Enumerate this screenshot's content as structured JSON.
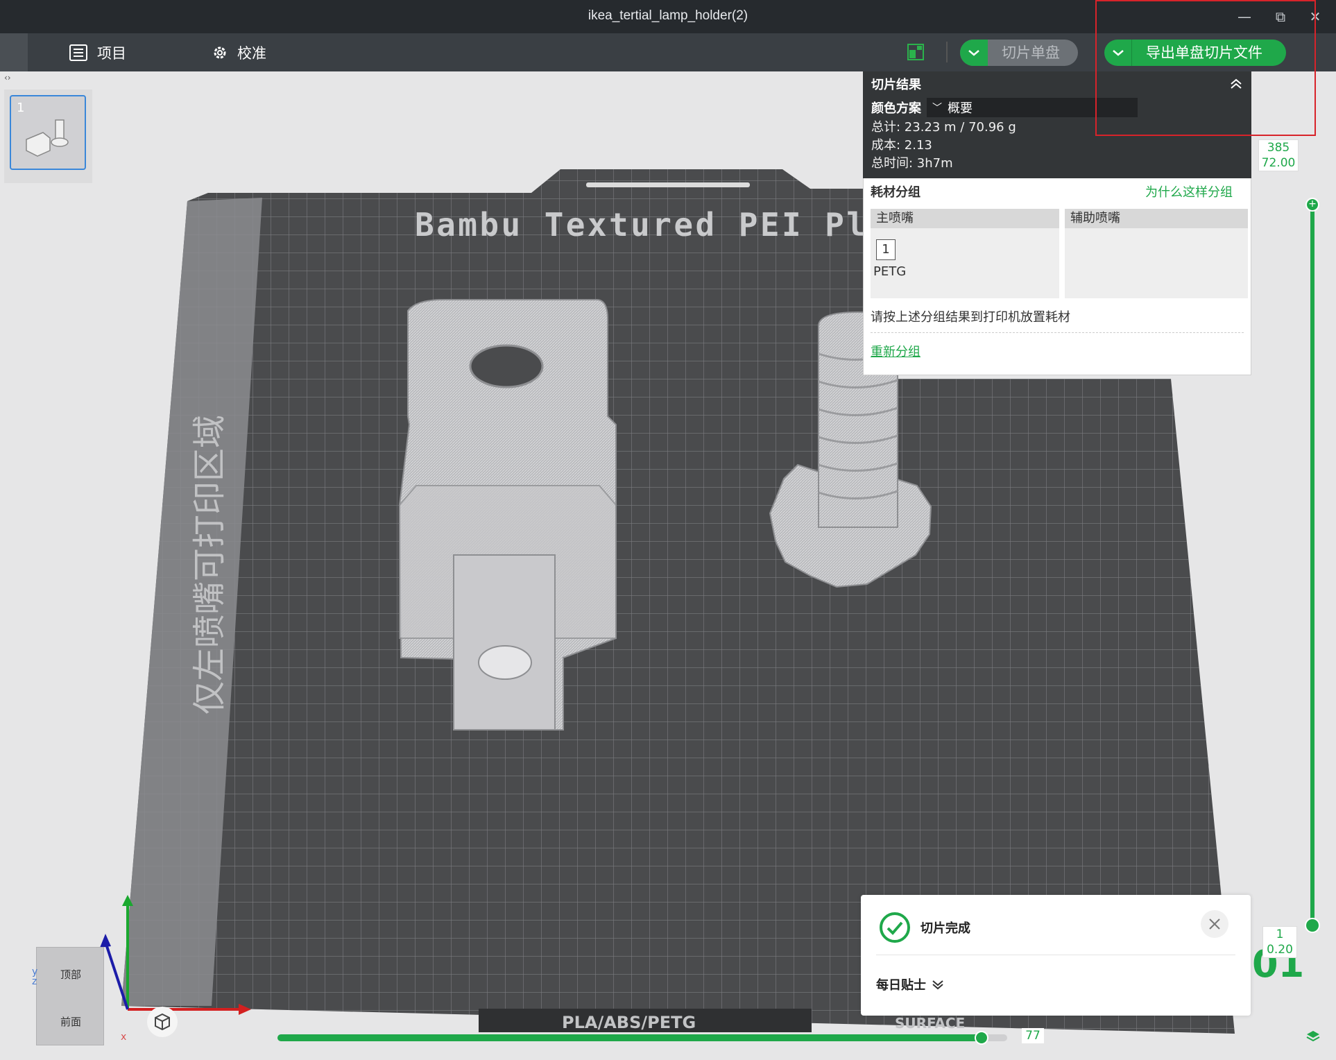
{
  "window": {
    "title": "ikea_tertial_lamp_holder(2)",
    "minimize": "—",
    "restore": "⧉",
    "close": "✕"
  },
  "menubar": {
    "project_label": "项目",
    "calibrate_label": "校准",
    "slice_label": "切片单盘",
    "export_label": "导出单盘切片文件"
  },
  "plate_list": {
    "plate_number": "1"
  },
  "scene": {
    "plate_brand": "Bambu Textured PEI Pl",
    "left_nozzle_area": "仅左喷嘴可打印区域",
    "plate_bottom_text": "PLA/ABS/PETG",
    "plate_bottom_text2": "SURFACE",
    "overlap_text": "01"
  },
  "slice_result": {
    "title": "切片结果",
    "color_scheme_label": "颜色方案",
    "color_scheme_value": "概要",
    "total": "总计: 23.23 m / 70.96 g",
    "cost": "成本: 2.13",
    "time": "总时间: 3h7m",
    "filament_group_title": "耗材分组",
    "why_link": "为什么这样分组",
    "main_nozzle": "主喷嘴",
    "aux_nozzle": "辅助喷嘴",
    "filament_slot": "1",
    "filament_type": "PETG",
    "instruction": "请按上述分组结果到打印机放置耗材",
    "regroup_link": "重新分组"
  },
  "toast": {
    "title": "切片完成",
    "tips_label": "每日贴士"
  },
  "layer_slider": {
    "top_layer": "385",
    "top_height": "72.00",
    "bottom_layer": "1",
    "bottom_height": "0.20"
  },
  "move_slider": {
    "value": "77",
    "progress": 0.965
  },
  "view_cube": {
    "top_label": "顶部",
    "front_label": "前面",
    "axis_y": "y",
    "axis_z": "z",
    "axis_x": "x"
  },
  "colors": {
    "accent_green": "#1fa84a",
    "titlebar": "#262a2e",
    "menubar": "#3a3f44",
    "plate": "#4a4b4d"
  }
}
